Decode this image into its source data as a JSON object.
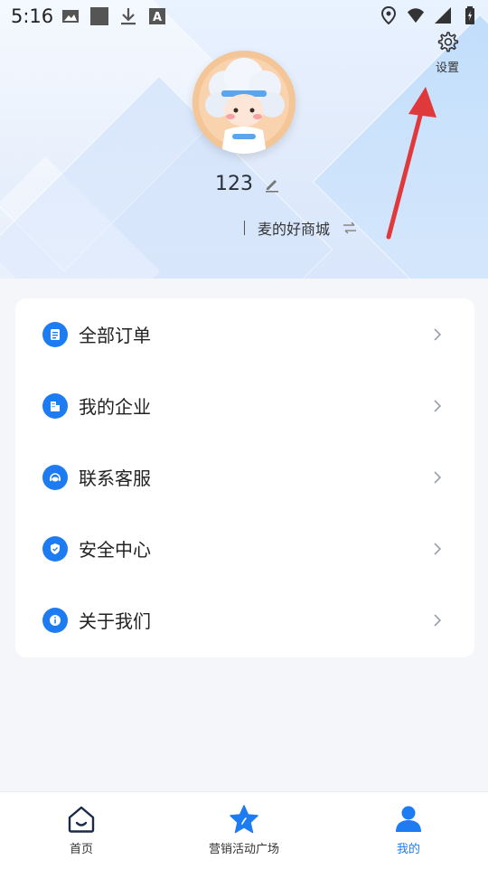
{
  "status_bar": {
    "time": "5:16",
    "left_icons": [
      "image-icon",
      "square-icon",
      "download-icon",
      "translate-a-icon"
    ],
    "right_icons": [
      "location-icon",
      "wifi-icon",
      "signal-icon",
      "battery-icon"
    ]
  },
  "header": {
    "settings_label": "设置",
    "username": "123",
    "shop_name": "麦的好商城"
  },
  "menu": {
    "items": [
      {
        "label": "全部订单",
        "icon": "order-list-icon"
      },
      {
        "label": "我的企业",
        "icon": "enterprise-icon"
      },
      {
        "label": "联系客服",
        "icon": "customer-service-icon"
      },
      {
        "label": "安全中心",
        "icon": "shield-icon"
      },
      {
        "label": "关于我们",
        "icon": "info-icon"
      }
    ]
  },
  "bottom_nav": {
    "items": [
      {
        "label": "首页",
        "icon": "home-icon",
        "active": false
      },
      {
        "label": "营销活动广场",
        "icon": "star-icon",
        "active": false
      },
      {
        "label": "我的",
        "icon": "user-icon",
        "active": true
      }
    ]
  },
  "colors": {
    "accent": "#1e7cf2",
    "annotation_arrow": "#e0393b"
  }
}
